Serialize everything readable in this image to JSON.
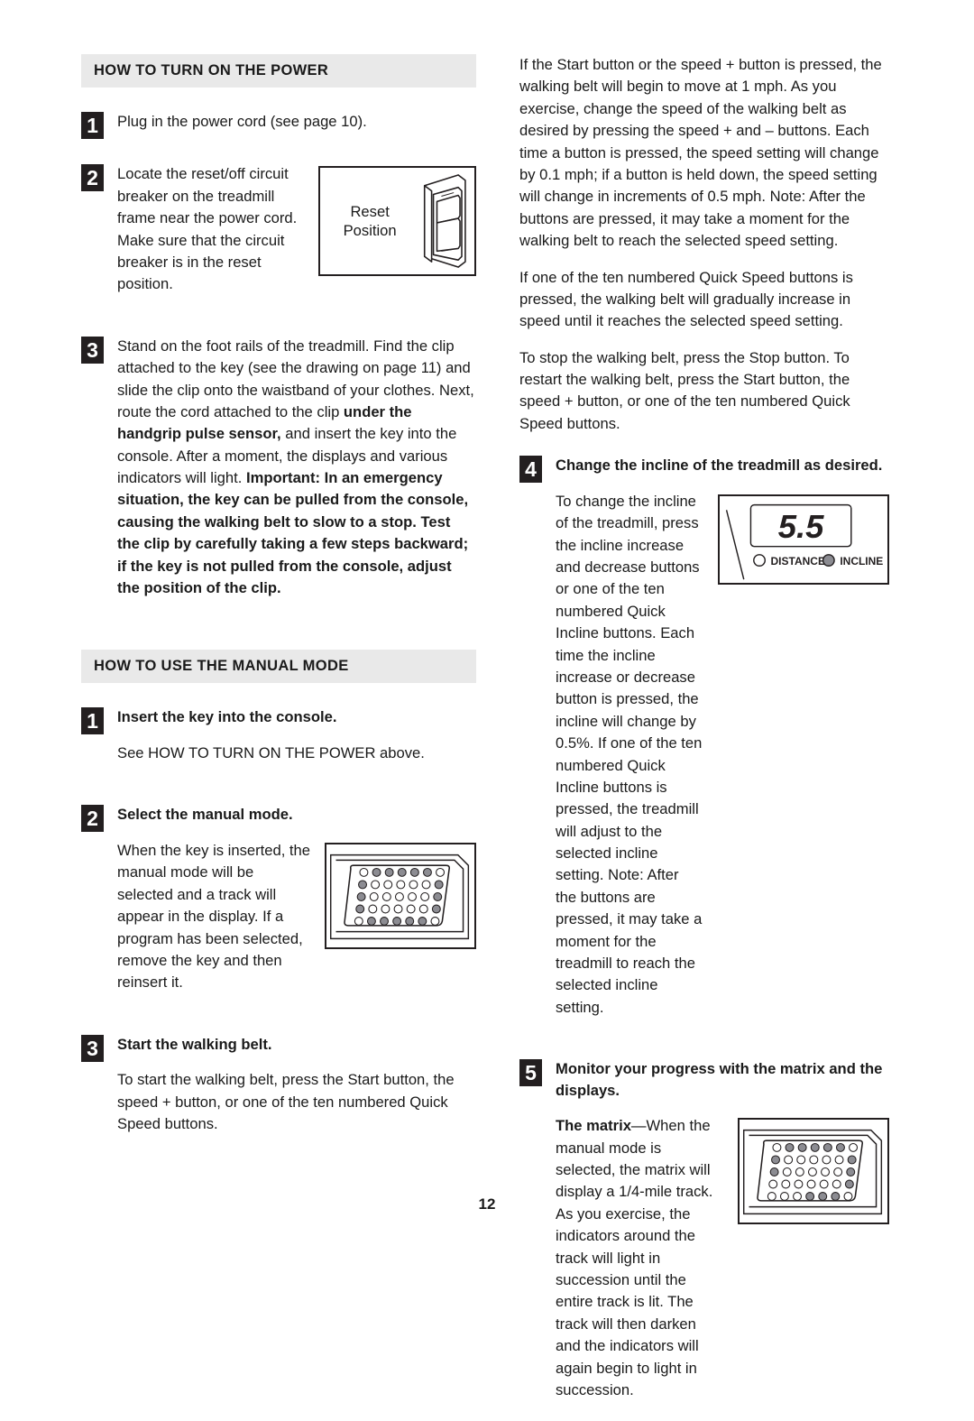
{
  "page_number": "12",
  "left_column": {
    "section1": {
      "heading": "HOW TO TURN ON THE POWER",
      "step1": {
        "number": "1",
        "text": "Plug in the power cord (see page 10)."
      },
      "step2": {
        "number": "2",
        "text": "Locate the reset/off circuit breaker on the treadmill frame near the power cord. Make sure that the circuit breaker is in the reset position.",
        "figure": {
          "name": "circuit-breaker-diagram",
          "label_line1": "Reset",
          "label_line2": "Position"
        }
      },
      "step3": {
        "number": "3",
        "text_part1": "Stand on the foot rails of the treadmill. Find the clip attached to the key (see the drawing on page 11) and slide the clip onto the waistband of your clothes. Next, route the cord attached to the clip ",
        "bold1": "under the handgrip pulse sensor,",
        "text_part2": " and insert the key into the console. After a moment, the displays and various indicators will light. ",
        "bold2": "Important: In an emergency situation, the key can be pulled from the console, causing the walking belt to slow to a stop. Test the clip by carefully taking a few steps backward; if the key is not pulled from the console, adjust the position of the clip."
      }
    },
    "section2": {
      "heading": "HOW TO USE THE MANUAL MODE",
      "step1": {
        "number": "1",
        "title": "Insert the key into the console.",
        "text": "See HOW TO TURN ON THE POWER above."
      },
      "step2": {
        "number": "2",
        "title": "Select the manual mode.",
        "text": "When the key is inserted, the manual mode will be selected and a track will appear in the display. If a program has been selected, remove the key and then reinsert it.",
        "figure": {
          "name": "matrix-full-track-diagram"
        }
      },
      "step3": {
        "number": "3",
        "title": "Start the walking belt.",
        "text": "To start the walking belt, press the Start button, the speed + button, or one of the ten numbered Quick Speed buttons."
      }
    }
  },
  "right_column": {
    "para1": "If the Start button or the speed + button is pressed, the walking belt will begin to move at 1 mph. As you exercise, change the speed of the walking belt as desired by pressing the speed + and – buttons. Each time a button is pressed, the speed setting will change by 0.1 mph; if a button is held down, the speed setting will change in increments of 0.5 mph. Note: After the buttons are pressed, it may take a moment for the walking belt to reach the selected speed setting.",
    "para2": "If one of the ten numbered Quick Speed buttons is pressed, the walking belt will gradually increase in speed until it reaches the selected speed setting.",
    "para3": "To stop the walking belt, press the Stop button. To restart the walking belt, press the Start button, the speed + button, or one of the ten numbered Quick Speed buttons.",
    "step4": {
      "number": "4",
      "title": "Change the incline of the treadmill as desired.",
      "text": "To change the incline of the treadmill, press the incline increase and decrease buttons or one of the ten numbered Quick Incline buttons. Each time the incline increase or decrease button is pressed, the incline will change by 0.5%. If one of the ten numbered Quick Incline buttons is pressed, the treadmill will adjust to the selected incline setting. Note: After the buttons are pressed, it may take a moment for the treadmill to reach the selected incline setting.",
      "figure": {
        "name": "incline-display-diagram",
        "value": "5.5",
        "indicator1_label": "DISTANCE",
        "indicator1_state": "off",
        "indicator2_label": "INCLINE",
        "indicator2_state": "on"
      }
    },
    "step5": {
      "number": "5",
      "title": "Monitor your progress with the matrix and the displays.",
      "bold_lead": "The matrix",
      "text": "—When the manual mode is selected, the matrix will display a 1/4-mile track. As you exercise, the indicators around the track will light in succession until the entire track is lit. The track will then darken and the indicators will again begin to light in succession.",
      "figure": {
        "name": "matrix-partial-track-diagram"
      }
    }
  },
  "colors": {
    "heading_bar": "#e9e9e9",
    "step_badge": "#231f20",
    "lit_dot": "#8c8c92",
    "ink": "#1a1a1a"
  }
}
